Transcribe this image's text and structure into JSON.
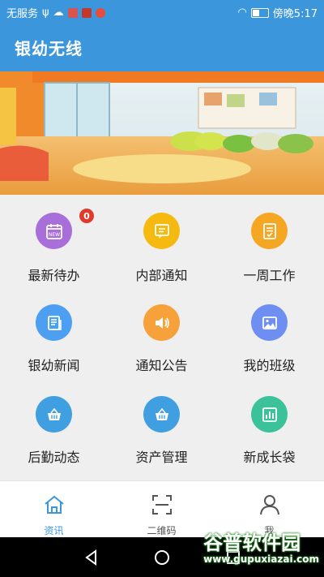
{
  "status_bar": {
    "carrier": "无服务",
    "time_text": "傍晚5:17"
  },
  "app": {
    "title": "银幼无线"
  },
  "grid": {
    "items": [
      {
        "label": "最新待办",
        "icon": "calendar-new-icon",
        "color": "#a86fda",
        "badge": "0"
      },
      {
        "label": "内部通知",
        "icon": "message-icon",
        "color": "#f5b90f"
      },
      {
        "label": "一周工作",
        "icon": "checklist-icon",
        "color": "#f5a623"
      },
      {
        "label": "银幼新闻",
        "icon": "news-icon",
        "color": "#4d9ff2"
      },
      {
        "label": "通知公告",
        "icon": "speaker-icon",
        "color": "#f7a13a"
      },
      {
        "label": "我的班级",
        "icon": "image-icon",
        "color": "#6f8ef2"
      },
      {
        "label": "后勤动态",
        "icon": "basket-icon",
        "color": "#3f9fe0"
      },
      {
        "label": "资产管理",
        "icon": "basket-icon",
        "color": "#3f9fe0"
      },
      {
        "label": "新成长袋",
        "icon": "bar-chart-icon",
        "color": "#3cc29a"
      }
    ]
  },
  "bottom_nav": {
    "items": [
      {
        "label": "资讯",
        "icon": "home-icon",
        "active": true
      },
      {
        "label": "二维码",
        "icon": "scan-icon",
        "active": false
      },
      {
        "label": "我",
        "icon": "person-icon",
        "active": false
      }
    ]
  },
  "watermark": {
    "line1": "谷普软件园",
    "line2": "www.gupuxiazai.com"
  },
  "colors": {
    "primary": "#3b96dc",
    "grid_bg": "#f0efef",
    "badge": "#e03a2d"
  }
}
